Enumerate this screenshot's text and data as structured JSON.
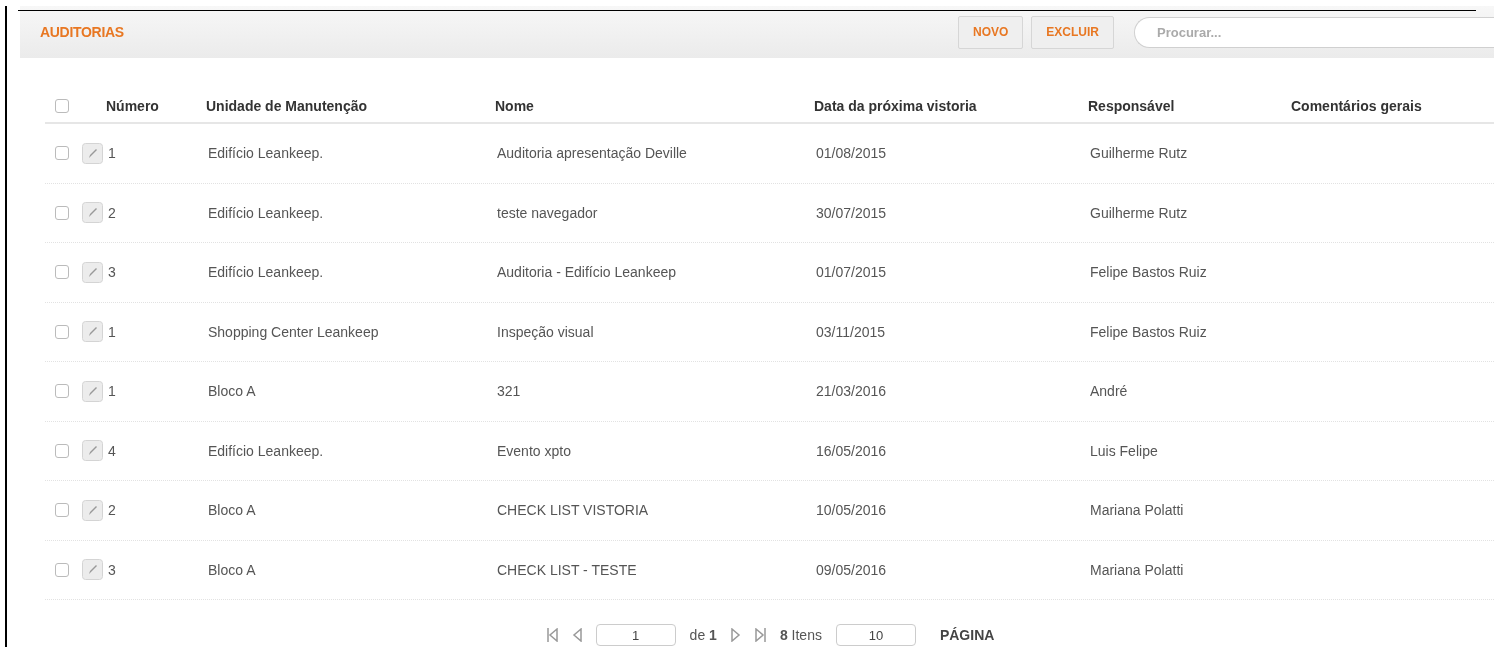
{
  "title": "AUDITORIAS",
  "buttons": [
    "NOVO",
    "EXCLUIR"
  ],
  "search": {
    "placeholder": "Procurar..."
  },
  "table": {
    "select_all_checked": false,
    "columns": [
      "Número",
      "Unidade de Manutenção",
      "Nome",
      "Data da próxima vistoria",
      "Responsável",
      "Comentários gerais"
    ],
    "rows": [
      {
        "checked": false,
        "cells": [
          "1",
          "Edifício Leankeep.",
          "Auditoria apresentação Deville",
          "01/08/2015",
          "Guilherme Rutz"
        ]
      },
      {
        "checked": false,
        "cells": [
          "2",
          "Edifício Leankeep.",
          "teste navegador",
          "30/07/2015",
          "Guilherme Rutz"
        ]
      },
      {
        "checked": false,
        "cells": [
          "3",
          "Edifício Leankeep.",
          "Auditoria - Edifício Leankeep",
          "01/07/2015",
          "Felipe Bastos Ruiz"
        ]
      },
      {
        "checked": false,
        "cells": [
          "1",
          "Shopping Center Leankeep",
          "Inspeção visual",
          "03/11/2015",
          "Felipe Bastos Ruiz"
        ]
      },
      {
        "checked": false,
        "cells": [
          "1",
          "Bloco A",
          "321",
          "21/03/2016",
          "André"
        ]
      },
      {
        "checked": false,
        "cells": [
          "4",
          "Edifício Leankeep.",
          "Evento xpto",
          "16/05/2016",
          "Luis Felipe"
        ]
      },
      {
        "checked": false,
        "cells": [
          "2",
          "Bloco A",
          "CHECK LIST VISTORIA",
          "10/05/2016",
          "Mariana Polatti"
        ]
      },
      {
        "checked": false,
        "cells": [
          "3",
          "Bloco A",
          "CHECK LIST - TESTE",
          "09/05/2016",
          "Mariana Polatti"
        ]
      }
    ]
  },
  "pager": {
    "page": "1",
    "of_text": "de **1**",
    "items_text": "**8** Itens",
    "page_size": "10",
    "page_label": "PÁGINA"
  }
}
